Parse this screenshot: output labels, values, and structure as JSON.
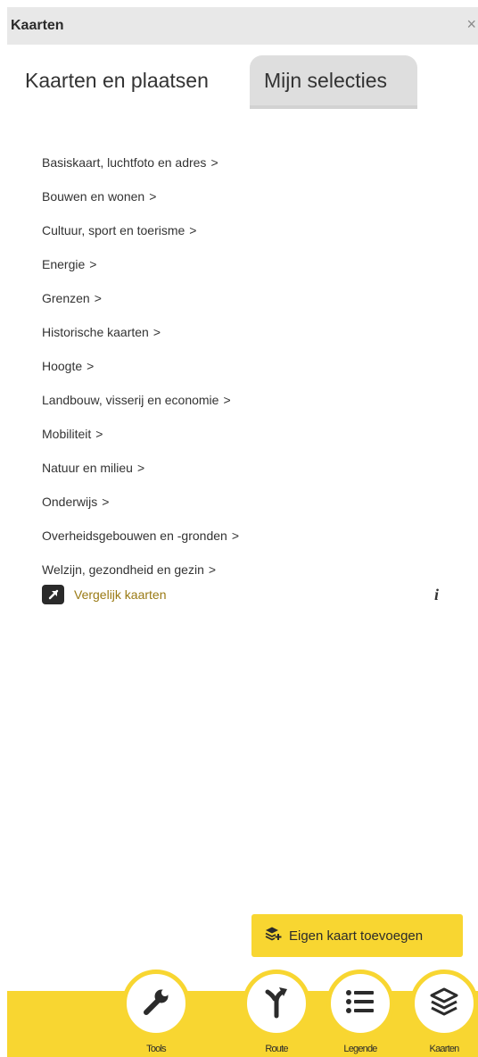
{
  "header": {
    "title": "Kaarten",
    "close_symbol": "×"
  },
  "tabs": [
    {
      "label": "Kaarten en plaatsen",
      "active": true
    },
    {
      "label": "Mijn selecties",
      "active": false
    }
  ],
  "categories": [
    "Basiskaart, luchtfoto en adres",
    "Bouwen en wonen",
    "Cultuur, sport en toerisme",
    "Energie",
    "Grenzen",
    "Historische kaarten",
    "Hoogte",
    "Landbouw, visserij en economie",
    "Mobiliteit",
    "Natuur en milieu",
    "Onderwijs",
    "Overheidsgebouwen en -gronden",
    "Welzijn, gezondheid en gezin"
  ],
  "chevron": ">",
  "compare": {
    "label": "Vergelijk kaarten",
    "icon": "external-link-icon"
  },
  "info": {
    "symbol": "i",
    "icon": "info-icon"
  },
  "add_map": {
    "label": "Eigen kaart toevoegen",
    "icon": "layers-add-icon"
  },
  "nav": [
    {
      "label": "Tools",
      "icon": "wrench-icon"
    },
    {
      "label": "Route",
      "icon": "route-icon"
    },
    {
      "label": "Legende",
      "icon": "list-icon"
    },
    {
      "label": "Kaarten",
      "icon": "layers-icon"
    }
  ],
  "colors": {
    "accent": "#f8d631",
    "link": "#9a7a14",
    "header_bg": "#e8e8e8",
    "tab_inactive": "#dedede"
  }
}
